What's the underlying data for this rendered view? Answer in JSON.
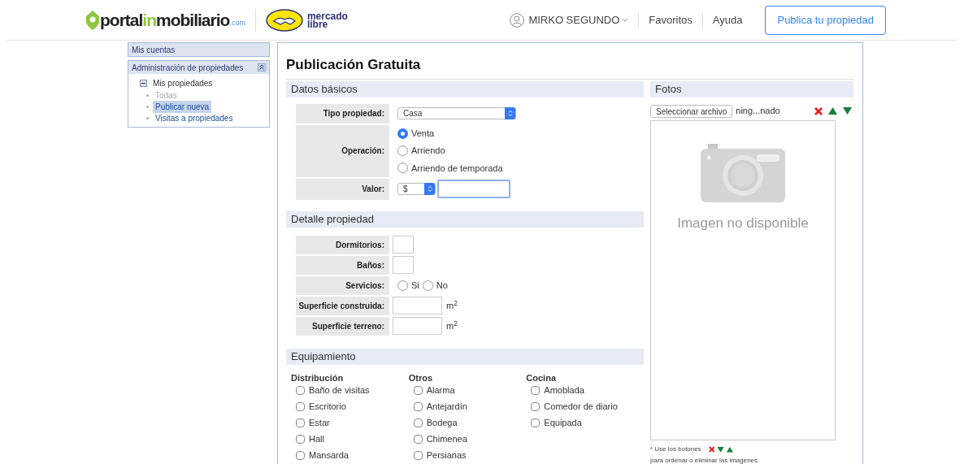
{
  "header": {
    "logo": {
      "parts": [
        "portal",
        "in",
        "mobiliario"
      ],
      "suffix": ".com"
    },
    "partner_logo": [
      "mercado",
      "libre"
    ],
    "user": "MIRKO SEGUNDO",
    "links": [
      "Favoritos",
      "Ayuda"
    ],
    "cta": "Publica tu propiedad"
  },
  "sidebar": {
    "sections": [
      {
        "title": "Mis cuentas",
        "collapsible": false
      },
      {
        "title": "Administración de propiedades",
        "collapsible": true,
        "expanded": true,
        "tree": {
          "label": "Mis propiedades",
          "expanded": true,
          "children": [
            {
              "label": "Todas",
              "disabled": true,
              "selected": false
            },
            {
              "label": "Publicar nueva",
              "disabled": false,
              "selected": true
            },
            {
              "label": "Visitas a propiedades",
              "disabled": false,
              "selected": false
            }
          ]
        }
      }
    ]
  },
  "main": {
    "title": "Publicación Gratuita",
    "basic": {
      "title": "Datos básicos",
      "tipo": {
        "label": "Tipo propiedad:",
        "value": "Casa"
      },
      "operacion": {
        "label": "Operación:",
        "options": [
          {
            "label": "Venta",
            "selected": true
          },
          {
            "label": "Arriendo",
            "selected": false
          },
          {
            "label": "Arriendo de temporada",
            "selected": false
          }
        ]
      },
      "valor": {
        "label": "Valor:",
        "currency": "$"
      }
    },
    "detail": {
      "title": "Detalle propiedad",
      "rows": [
        {
          "kind": "small",
          "label": "Dormitorios:"
        },
        {
          "kind": "small",
          "label": "Baños:"
        },
        {
          "kind": "radio",
          "label": "Servicios:",
          "options": [
            {
              "label": "Si",
              "selected": false
            },
            {
              "label": "No",
              "selected": false
            }
          ]
        },
        {
          "kind": "area",
          "label": "Superficie construida:",
          "unit": "m$^{2}$"
        },
        {
          "kind": "area",
          "label": "Superficie terreno:",
          "unit": "m$^{2}$"
        }
      ]
    },
    "equipment": {
      "title": "Equipamiento",
      "groups": [
        {
          "title": "Distribución",
          "items": [
            {
              "label": "Baño de visitas",
              "checked": false
            },
            {
              "label": "Escritorio",
              "checked": false
            },
            {
              "label": "Estar",
              "checked": false
            },
            {
              "label": "Hall",
              "checked": false
            },
            {
              "label": "Mansarda",
              "checked": false
            }
          ]
        },
        {
          "title": "Otros",
          "items": [
            {
              "label": "Alarma",
              "checked": false
            },
            {
              "label": "Antejardín",
              "checked": false
            },
            {
              "label": "Bodega",
              "checked": false
            },
            {
              "label": "Chimenea",
              "checked": false
            },
            {
              "label": "Persianas",
              "checked": false
            }
          ]
        },
        {
          "title": "Cocina",
          "items": [
            {
              "label": "Amoblada",
              "checked": false
            },
            {
              "label": "Comedor de diario",
              "checked": false
            },
            {
              "label": "Equipada",
              "checked": false
            }
          ]
        }
      ]
    },
    "photos": {
      "title": "Fotos",
      "file_button": "Seleccionar archivo",
      "file_name": "ning...nado",
      "placeholder_text": "Imagen no disponible",
      "note_start": "* Use los botones",
      "note_end": "para ordenar o eliminar las imágenes."
    }
  }
}
